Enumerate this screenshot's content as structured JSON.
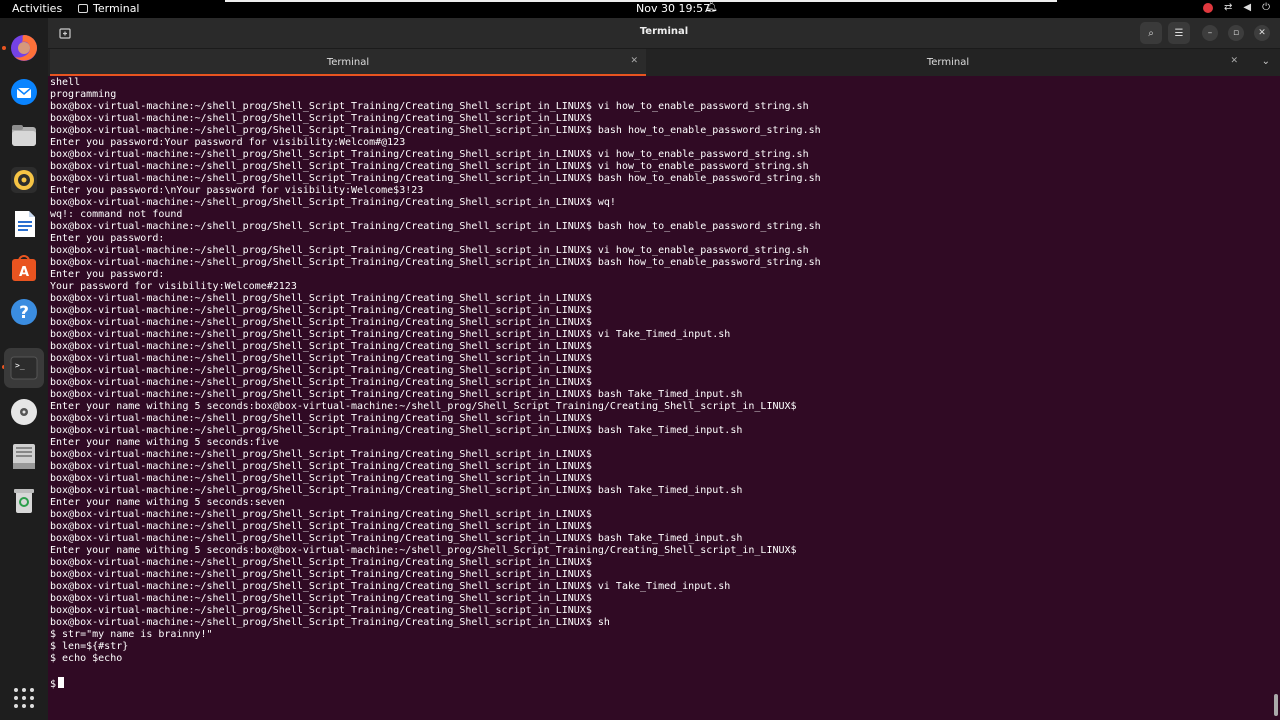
{
  "topbar": {
    "activities": "Activities",
    "app_name": "Terminal",
    "datetime": "Nov 30  19:57"
  },
  "dock": {
    "items": [
      "firefox-icon",
      "thunderbird-icon",
      "files-icon",
      "rhythmbox-icon",
      "writer-icon",
      "software-icon",
      "help-icon",
      "terminal-icon",
      "disc-icon",
      "drive-icon",
      "trash-icon",
      "show-apps-icon"
    ]
  },
  "window": {
    "title": "Terminal",
    "tabs": [
      {
        "label": "Terminal",
        "active": true
      },
      {
        "label": "Terminal",
        "active": false
      }
    ]
  },
  "terminal": {
    "lines": [
      "shell",
      "programming",
      "box@box-virtual-machine:~/shell_prog/Shell_Script_Training/Creating_Shell_script_in_LINUX$ vi how_to_enable_password_string.sh",
      "box@box-virtual-machine:~/shell_prog/Shell_Script_Training/Creating_Shell_script_in_LINUX$",
      "box@box-virtual-machine:~/shell_prog/Shell_Script_Training/Creating_Shell_script_in_LINUX$ bash how_to_enable_password_string.sh",
      "Enter you password:Your password for visibility:Welcom#@123",
      "box@box-virtual-machine:~/shell_prog/Shell_Script_Training/Creating_Shell_script_in_LINUX$ vi how_to_enable_password_string.sh",
      "box@box-virtual-machine:~/shell_prog/Shell_Script_Training/Creating_Shell_script_in_LINUX$ vi how_to_enable_password_string.sh",
      "box@box-virtual-machine:~/shell_prog/Shell_Script_Training/Creating_Shell_script_in_LINUX$ bash how_to_enable_password_string.sh",
      "Enter you password:\\nYour password for visibility:Welcome$3!23",
      "box@box-virtual-machine:~/shell_prog/Shell_Script_Training/Creating_Shell_script_in_LINUX$ wq!",
      "wq!: command not found",
      "box@box-virtual-machine:~/shell_prog/Shell_Script_Training/Creating_Shell_script_in_LINUX$ bash how_to_enable_password_string.sh",
      "Enter you password:",
      "box@box-virtual-machine:~/shell_prog/Shell_Script_Training/Creating_Shell_script_in_LINUX$ vi how_to_enable_password_string.sh",
      "box@box-virtual-machine:~/shell_prog/Shell_Script_Training/Creating_Shell_script_in_LINUX$ bash how_to_enable_password_string.sh",
      "Enter you password:",
      "Your password for visibility:Welcome#2123",
      "box@box-virtual-machine:~/shell_prog/Shell_Script_Training/Creating_Shell_script_in_LINUX$",
      "box@box-virtual-machine:~/shell_prog/Shell_Script_Training/Creating_Shell_script_in_LINUX$",
      "box@box-virtual-machine:~/shell_prog/Shell_Script_Training/Creating_Shell_script_in_LINUX$",
      "box@box-virtual-machine:~/shell_prog/Shell_Script_Training/Creating_Shell_script_in_LINUX$ vi Take_Timed_input.sh",
      "box@box-virtual-machine:~/shell_prog/Shell_Script_Training/Creating_Shell_script_in_LINUX$",
      "box@box-virtual-machine:~/shell_prog/Shell_Script_Training/Creating_Shell_script_in_LINUX$",
      "box@box-virtual-machine:~/shell_prog/Shell_Script_Training/Creating_Shell_script_in_LINUX$",
      "box@box-virtual-machine:~/shell_prog/Shell_Script_Training/Creating_Shell_script_in_LINUX$",
      "box@box-virtual-machine:~/shell_prog/Shell_Script_Training/Creating_Shell_script_in_LINUX$ bash Take_Timed_input.sh",
      "Enter your name withing 5 seconds:box@box-virtual-machine:~/shell_prog/Shell_Script_Training/Creating_Shell_script_in_LINUX$",
      "box@box-virtual-machine:~/shell_prog/Shell_Script_Training/Creating_Shell_script_in_LINUX$",
      "box@box-virtual-machine:~/shell_prog/Shell_Script_Training/Creating_Shell_script_in_LINUX$ bash Take_Timed_input.sh",
      "Enter your name withing 5 seconds:five",
      "box@box-virtual-machine:~/shell_prog/Shell_Script_Training/Creating_Shell_script_in_LINUX$",
      "box@box-virtual-machine:~/shell_prog/Shell_Script_Training/Creating_Shell_script_in_LINUX$",
      "box@box-virtual-machine:~/shell_prog/Shell_Script_Training/Creating_Shell_script_in_LINUX$",
      "box@box-virtual-machine:~/shell_prog/Shell_Script_Training/Creating_Shell_script_in_LINUX$ bash Take_Timed_input.sh",
      "Enter your name withing 5 seconds:seven",
      "box@box-virtual-machine:~/shell_prog/Shell_Script_Training/Creating_Shell_script_in_LINUX$",
      "box@box-virtual-machine:~/shell_prog/Shell_Script_Training/Creating_Shell_script_in_LINUX$",
      "box@box-virtual-machine:~/shell_prog/Shell_Script_Training/Creating_Shell_script_in_LINUX$ bash Take_Timed_input.sh",
      "Enter your name withing 5 seconds:box@box-virtual-machine:~/shell_prog/Shell_Script_Training/Creating_Shell_script_in_LINUX$",
      "box@box-virtual-machine:~/shell_prog/Shell_Script_Training/Creating_Shell_script_in_LINUX$",
      "box@box-virtual-machine:~/shell_prog/Shell_Script_Training/Creating_Shell_script_in_LINUX$",
      "box@box-virtual-machine:~/shell_prog/Shell_Script_Training/Creating_Shell_script_in_LINUX$ vi Take_Timed_input.sh",
      "box@box-virtual-machine:~/shell_prog/Shell_Script_Training/Creating_Shell_script_in_LINUX$",
      "box@box-virtual-machine:~/shell_prog/Shell_Script_Training/Creating_Shell_script_in_LINUX$",
      "box@box-virtual-machine:~/shell_prog/Shell_Script_Training/Creating_Shell_script_in_LINUX$ sh",
      "$ str=\"my name is brainny!\"",
      "$ len=${#str}",
      "$ echo $echo",
      ""
    ],
    "prompt": "$"
  },
  "colors": {
    "terminal_bg": "#300a24",
    "accent": "#e95420"
  }
}
